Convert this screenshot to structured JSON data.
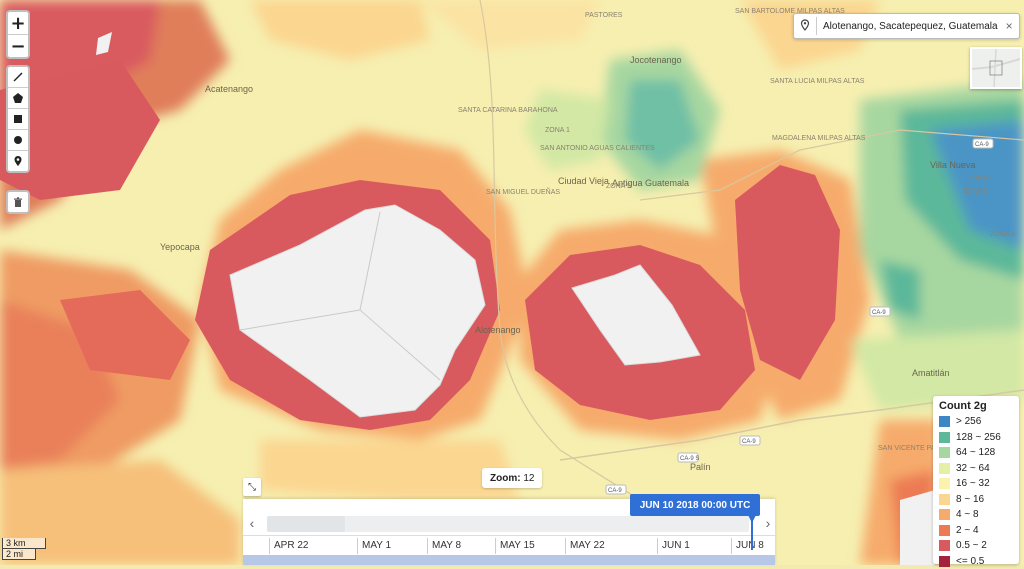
{
  "map": {
    "place_labels": [
      "Acatenango",
      "SANTA CATARINA BARAHONA",
      "ZONA 1",
      "SAN ANTONIO AGUAS CALIENTES",
      "Antigua Guatemala",
      "Ciudad Vieja",
      "Jocotenango",
      "Villa Nueva",
      "ZONA 1",
      "ZONA 5",
      "Alotenango",
      "Amatitlán",
      "Palín",
      "SAN VICENTE PACAYA",
      "SANTA LUCIA MILPAS ALTAS",
      "MAGDALENA MILPAS ALTAS",
      "SAN MIGUEL DUEÑAS",
      "Yepocapa",
      "PASTORES",
      "SAN BARTOLOME MILPAS ALTAS",
      "ZONA 4",
      "ZONA 5"
    ],
    "road_labels": [
      "CA-9",
      "CA-9",
      "CA-9",
      "CA-9",
      "CA-9 S"
    ]
  },
  "draw_toolbar": {
    "icons": [
      "line-icon",
      "polygon-icon",
      "rectangle-icon",
      "circle-icon",
      "marker-icon",
      "trash-icon"
    ]
  },
  "zoom_controls": {
    "zoom_in": "+",
    "zoom_out": "−"
  },
  "search": {
    "location": "Alotenango, Sacatepequez, Guatemala",
    "clear": "×"
  },
  "legend": {
    "title": "Count 2g",
    "items": [
      {
        "label": "> 256",
        "color": "#3a87c4"
      },
      {
        "label": "128 ~ 256",
        "color": "#5cb89a"
      },
      {
        "label": "64 ~ 128",
        "color": "#a7d7a0"
      },
      {
        "label": "32 ~ 64",
        "color": "#e4f0a4"
      },
      {
        "label": "16 ~ 32",
        "color": "#fbf2ae"
      },
      {
        "label": "8 ~ 16",
        "color": "#fbd690"
      },
      {
        "label": "4 ~ 8",
        "color": "#f6ab6c"
      },
      {
        "label": "2 ~ 4",
        "color": "#ec7a53"
      },
      {
        "label": "0.5 ~ 2",
        "color": "#d95a5e"
      },
      {
        "label": "<= 0.5",
        "color": "#a5223f"
      }
    ]
  },
  "zoom": {
    "label": "Zoom:",
    "value": "12"
  },
  "timeline": {
    "current": "JUN 10 2018 00:00 UTC",
    "ticks": [
      "APR 22",
      "MAY 1",
      "MAY 8",
      "MAY 15",
      "MAY 22",
      "JUN 1",
      "JUN 8"
    ],
    "prev": "‹",
    "next": "›"
  },
  "scale": {
    "metric": "3 km",
    "imperial": "2 mi"
  }
}
